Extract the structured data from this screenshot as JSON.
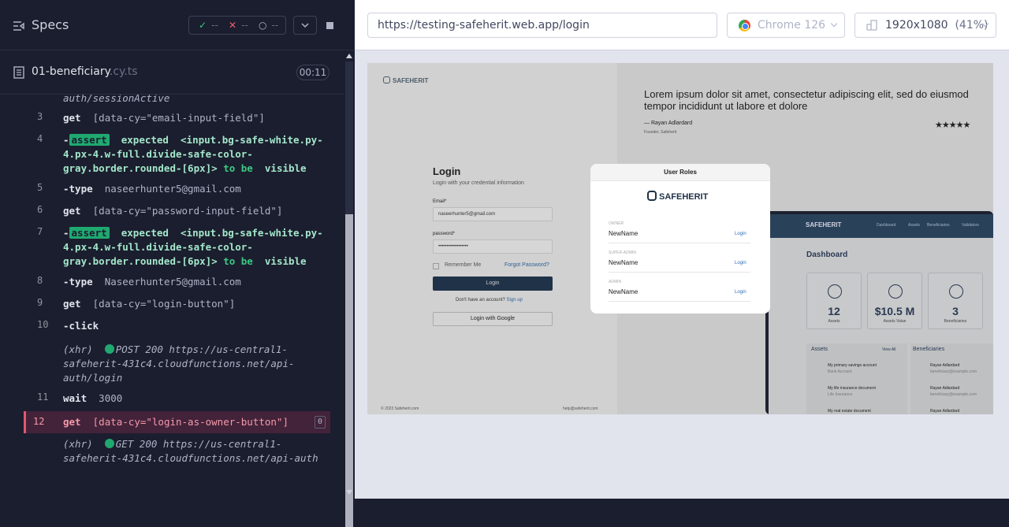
{
  "specs_panel": {
    "title": "Specs",
    "stats": {
      "passed": "--",
      "failed": "--",
      "pending": "--"
    },
    "spec_file": {
      "name": "01-beneficiary",
      "ext": ".cy.ts",
      "duration": "00:11"
    }
  },
  "commands": [
    {
      "num": "",
      "prev_text": "auth/sessionActive"
    },
    {
      "num": "3",
      "name": "get",
      "selector": "[data-cy=\"email-input-field\"]"
    },
    {
      "num": "4",
      "name": "-assert",
      "badge": "assert",
      "text1": "expected",
      "text2": "<input.bg-safe-white.py-4.px-4.w-full.divide-safe-color-gray.border.rounded-[6px]>",
      "text3": "to be",
      "text4": "visible"
    },
    {
      "num": "5",
      "name": "-type",
      "value": "naseerhunter5@gmail.com"
    },
    {
      "num": "6",
      "name": "get",
      "selector": "[data-cy=\"password-input-field\"]"
    },
    {
      "num": "7",
      "name": "-assert",
      "badge": "assert",
      "text1": "expected",
      "text2": "<input.bg-safe-white.py-4.px-4.w-full.divide-safe-color-gray.border.rounded-[6px]>",
      "text3": "to be",
      "text4": "visible"
    },
    {
      "num": "8",
      "name": "-type",
      "value": "Naseerhunter5@gmail.com"
    },
    {
      "num": "9",
      "name": "get",
      "selector": "[data-cy=\"login-button\"]"
    },
    {
      "num": "10",
      "name": "-click"
    },
    {
      "num": "",
      "xhr": "(xhr)",
      "xhr_text": "POST 200 https://us-central1-safeherit-431c4.cloudfunctions.net/api-auth/login"
    },
    {
      "num": "11",
      "name": "wait",
      "value": "3000"
    },
    {
      "num": "12",
      "name": "get",
      "selector": "[data-cy=\"login-as-owner-button\"]",
      "count": "0"
    },
    {
      "num": "",
      "xhr": "(xhr)",
      "xhr_text": "GET 200 https://us-central1-safeherit-431c4.cloudfunctions.net/api-auth"
    }
  ],
  "browser_bar": {
    "url": "https://testing-safeherit.web.app/login",
    "browser": "Chrome 126",
    "viewport": "1920x1080",
    "zoom": "(41%)"
  },
  "aut": {
    "brand": "SAFEHERIT",
    "login_title": "Login",
    "login_subtitle": "Login with your credential information",
    "email_label": "Email*",
    "email_value": "naseerhunter5@gmail.com",
    "password_label": "password*",
    "password_value": "••••••••••••••••••",
    "remember": "Remember Me",
    "forgot": "Forgot Password?",
    "login_btn": "Login",
    "no_account": "Don't have an account?",
    "signup": "Sign up",
    "google_btn": "Login with Google",
    "copyright": "© 2023 Safeherit.com",
    "help_email": "help@safeherit.com",
    "quote": "Lorem ipsum dolor sit amet, consectetur adipiscing elit, sed do eiusmod tempor incididunt ut labore et dolore",
    "author": "Rayan Adlardard",
    "author_role": "Founder, Safeherit",
    "stars": "★★★★★",
    "dash_nav": [
      "Dashboard",
      "Assets",
      "Beneficiaries",
      "Validators"
    ],
    "dash_title": "Dashboard",
    "cards": [
      {
        "value": "12",
        "label": "Assets"
      },
      {
        "value": "$10.5 M",
        "label": "Assets Value"
      },
      {
        "value": "3",
        "label": "Beneficiaries"
      }
    ],
    "assets_title": "Assets",
    "view_all": "View All",
    "assets": [
      {
        "name": "My primary savings account",
        "sub": "Bank Account"
      },
      {
        "name": "My life insurance document",
        "sub": "Life Insurance"
      },
      {
        "name": "My real estate document",
        "sub": ""
      }
    ],
    "beneficiaries_title": "Beneficiaries",
    "beneficiaries": [
      {
        "name": "Rayan Adlardard",
        "sub": "beneficiary@example.com"
      },
      {
        "name": "Rayan Adlardard",
        "sub": "beneficiary@example.com"
      },
      {
        "name": "Rayan Adlardard",
        "sub": ""
      }
    ],
    "modal": {
      "title": "User Roles",
      "brand": "SAFEHERIT",
      "roles": [
        {
          "role": "OWNER",
          "name": "NewName",
          "action": "Login"
        },
        {
          "role": "SUPER-ADMIN",
          "name": "NewName",
          "action": "Login"
        },
        {
          "role": "ADMIN",
          "name": "NewName",
          "action": "Login"
        }
      ]
    }
  },
  "colors": {
    "pass": "#3bc982",
    "fail": "#f05d71",
    "active": "#e45770",
    "panel_bg": "#1b1e2e"
  }
}
